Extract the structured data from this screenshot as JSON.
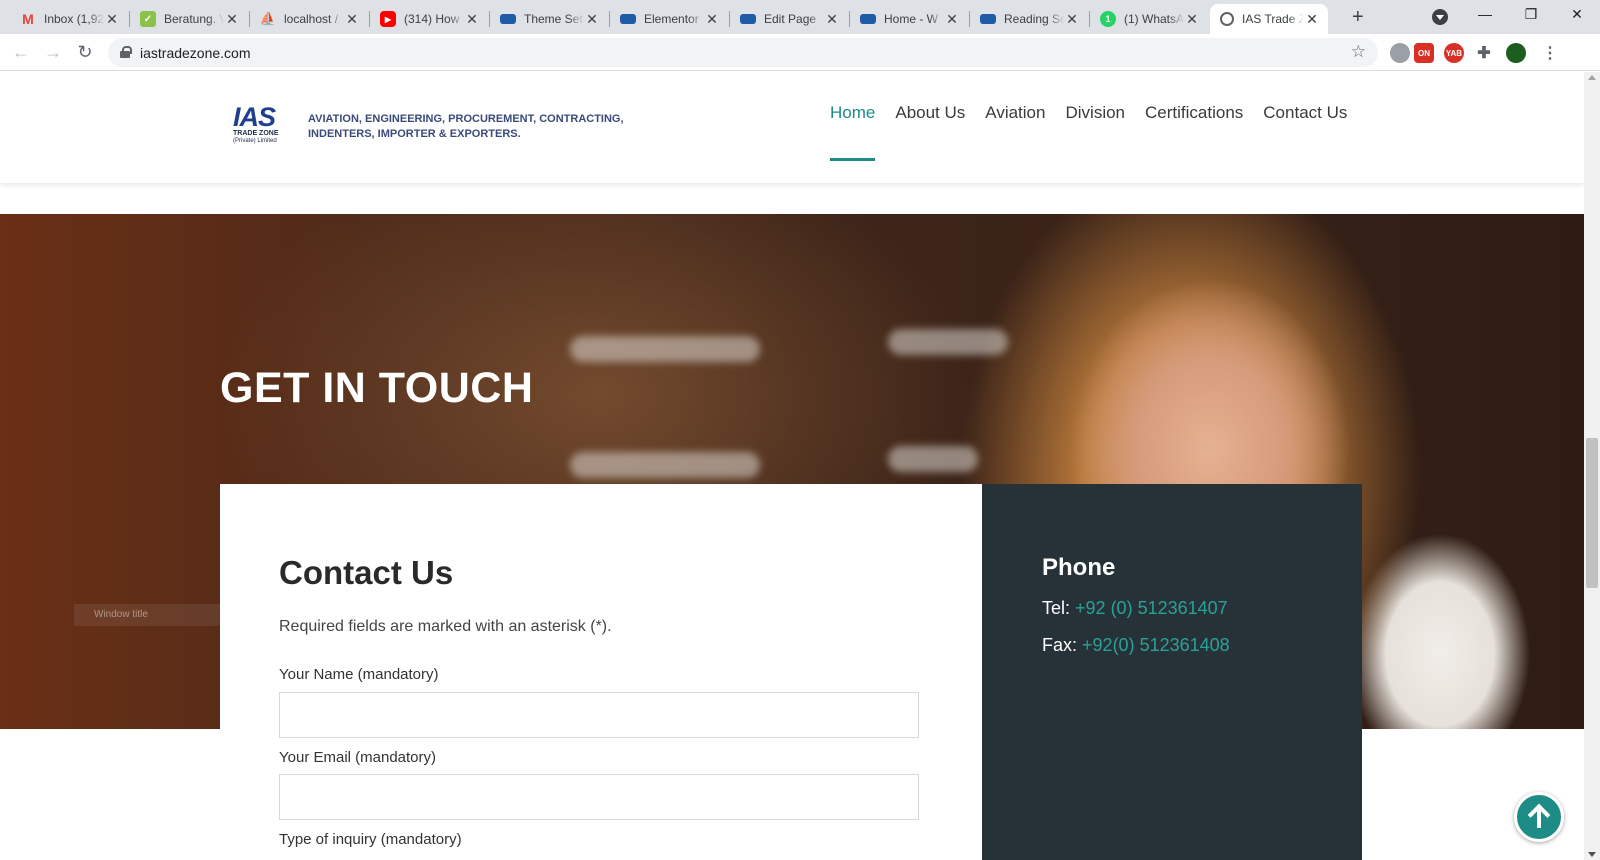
{
  "browser": {
    "tabs": [
      {
        "label": "Inbox (1,92",
        "icon": "gmail-icon",
        "color": "#ea4335"
      },
      {
        "label": "Beratung. V",
        "icon": "leaf-icon",
        "color": "#8bc34a"
      },
      {
        "label": "localhost / ",
        "icon": "phpmyadmin-icon",
        "color": "#f39c12"
      },
      {
        "label": "(314) How",
        "icon": "youtube-icon",
        "color": "#ff0000"
      },
      {
        "label": "Theme Set",
        "icon": "site-icon",
        "color": "#1f5aa6"
      },
      {
        "label": "Elementor",
        "icon": "site-icon",
        "color": "#1f5aa6"
      },
      {
        "label": "Edit Page ",
        "icon": "site-icon",
        "color": "#1f5aa6"
      },
      {
        "label": "Home - W",
        "icon": "site-icon",
        "color": "#1f5aa6"
      },
      {
        "label": "Reading Se",
        "icon": "site-icon",
        "color": "#1f5aa6"
      },
      {
        "label": "(1) WhatsA",
        "icon": "whatsapp-icon",
        "color": "#25d366"
      },
      {
        "label": "IAS Trade Z",
        "icon": "globe-icon",
        "color": "#5f6368",
        "active": true
      }
    ],
    "url": "iastradezone.com",
    "extensions": {
      "zon_badge": "ON",
      "yab_badge": "YAB"
    }
  },
  "header": {
    "logo_mark": "IAS",
    "logo_sub": "TRADE ZONE",
    "logo_sub2": "(Private) Limited",
    "tagline": "AVIATION, ENGINEERING, PROCUREMENT, CONTRACTING, INDENTERS, IMPORTER & EXPORTERS.",
    "nav": [
      {
        "label": "Home",
        "active": true
      },
      {
        "label": "About Us"
      },
      {
        "label": "Aviation"
      },
      {
        "label": "Division"
      },
      {
        "label": "Certifications"
      },
      {
        "label": "Contact Us"
      }
    ]
  },
  "hero": {
    "title": "GET IN TOUCH",
    "badge": "Window title"
  },
  "contact": {
    "title": "Contact Us",
    "note": "Required fields are marked with an asterisk (*).",
    "fields": [
      {
        "label": "Your Name (mandatory)",
        "value": ""
      },
      {
        "label": "Your Email (mandatory)",
        "value": ""
      },
      {
        "label": "Type of inquiry (mandatory)"
      }
    ]
  },
  "info": {
    "title": "Phone",
    "tel_label": "Tel:",
    "tel_value": "+92 (0) 512361407",
    "fax_label": "Fax:",
    "fax_value": "+92(0) 512361408"
  },
  "colors": {
    "accent": "#1d8c86",
    "info_panel": "#263238",
    "link": "#2aa198"
  }
}
